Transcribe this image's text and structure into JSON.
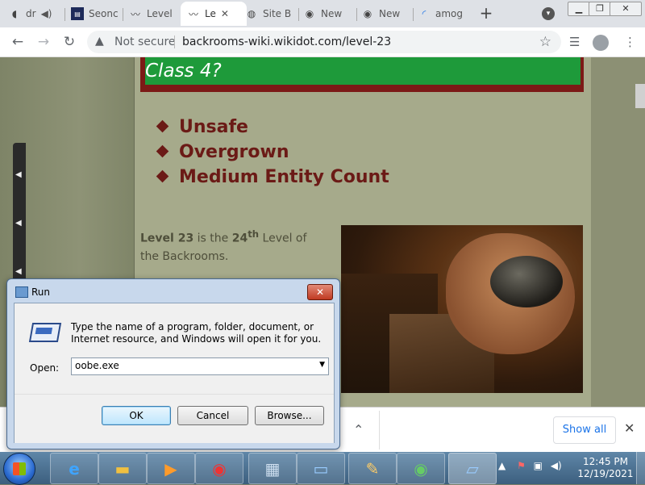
{
  "browser": {
    "tabs": [
      {
        "icon": "speaker-icon",
        "label": "dr"
      },
      {
        "icon": "book-icon",
        "label": "Seonc"
      },
      {
        "icon": "wikidot-icon",
        "label": "Level"
      },
      {
        "icon": "wikidot-icon",
        "label": "Le",
        "active": true
      },
      {
        "icon": "globe-icon",
        "label": "Site B"
      },
      {
        "icon": "chrome-icon",
        "label": "New"
      },
      {
        "icon": "chrome-icon",
        "label": "New"
      },
      {
        "icon": "loading-icon",
        "label": "amog"
      }
    ],
    "close_glyph": "✕",
    "new_tab_glyph": "+",
    "not_secure": "Not secure",
    "url": "backrooms-wiki.wikidot.com/level-23"
  },
  "page": {
    "banner_title": "Class 4?",
    "class_items": [
      "Unsafe",
      "Overgrown",
      "Medium Entity Count"
    ],
    "intro_bold": "Level 23",
    "intro_mid": " is the ",
    "intro_ordinal": "24",
    "intro_sup": "th",
    "intro_end": " Level of the Backrooms."
  },
  "download_bar": {
    "show_all": "Show all"
  },
  "run_dialog": {
    "title": "Run",
    "message": "Type the name of a program, folder, document, or Internet resource, and Windows will open it for you.",
    "open_label": "Open:",
    "open_value": "oobe.exe",
    "ok": "OK",
    "cancel": "Cancel",
    "browse": "Browse..."
  },
  "taskbar": {
    "apps": [
      "ie-icon",
      "explorer-icon",
      "media-player-icon",
      "chrome-icon",
      "control-panel-icon",
      "photos-icon",
      "paint-icon",
      "windows-update-icon",
      "run-icon"
    ],
    "time": "12:45 PM",
    "date": "12/19/2021"
  },
  "colors": {
    "banner_red": "#7c1a16",
    "banner_green": "#1e9a3a",
    "class_text": "#6b1a16",
    "link_blue": "#1a73e8"
  }
}
